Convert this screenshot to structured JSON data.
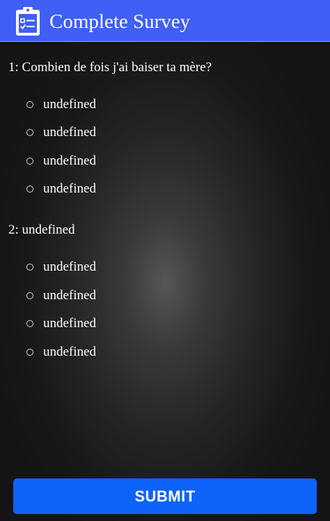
{
  "header": {
    "title": "Complete Survey",
    "icon": "clipboard-check-icon",
    "background_color": "#3f5ff5"
  },
  "questions": [
    {
      "text": "1: Combien de fois j'ai baiser ta mère?",
      "options": [
        "undefined",
        "undefined",
        "undefined",
        "undefined"
      ]
    },
    {
      "text": "2: undefined",
      "options": [
        "undefined",
        "undefined",
        "undefined",
        "undefined"
      ]
    }
  ],
  "submit": {
    "label": "SUBMIT",
    "color": "#0d63fa"
  }
}
